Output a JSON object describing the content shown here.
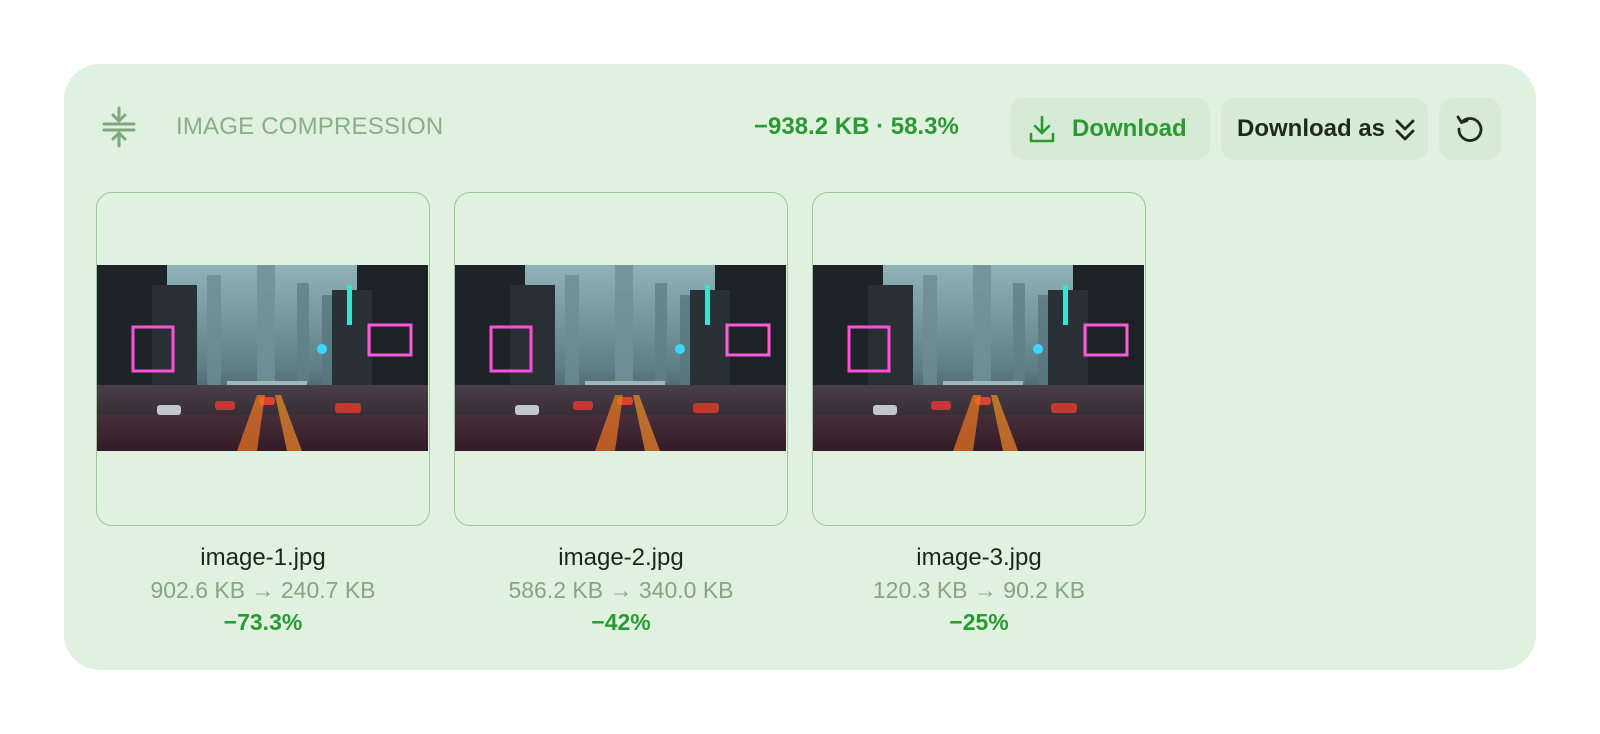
{
  "header": {
    "title": "IMAGE COMPRESSION",
    "summary": "−938.2 KB · 58.3%",
    "download_label": "Download",
    "download_as_label": "Download as"
  },
  "icons": {
    "compress": "compress-icon",
    "download": "download-icon",
    "download_as": "chevrons-down-icon",
    "reset": "reset-icon"
  },
  "colors": {
    "card_bg": "#e0f1df",
    "accent": "#2a9a33",
    "muted": "#85a585",
    "button_bg": "#d7ead6"
  },
  "images": [
    {
      "name": "image-1.jpg",
      "sizes": "902.6 KB → 240.7 KB",
      "reduction": "−73.3%"
    },
    {
      "name": "image-2.jpg",
      "sizes": "586.2 KB → 340.0 KB",
      "reduction": "−42%"
    },
    {
      "name": "image-3.jpg",
      "sizes": "120.3 KB → 90.2 KB",
      "reduction": "−25%"
    }
  ]
}
